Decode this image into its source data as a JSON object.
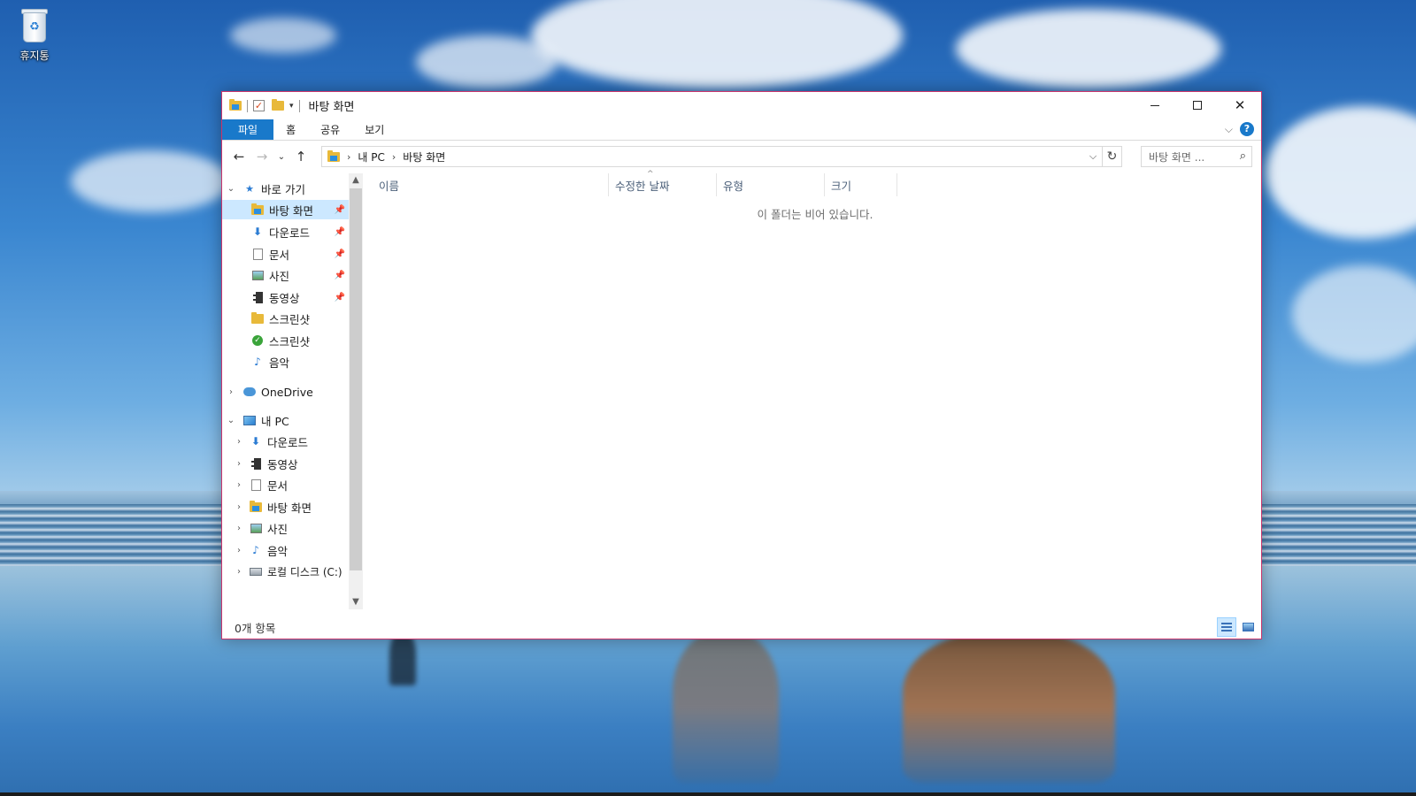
{
  "desktop": {
    "recycle_bin_label": "휴지통"
  },
  "window": {
    "title": "바탕 화면",
    "accent_color": "#1979ca",
    "border_color": "#c9356c",
    "controls": {
      "minimize": "minimize",
      "maximize": "maximize",
      "close": "✕"
    }
  },
  "ribbon": {
    "tabs": [
      {
        "label": "파일",
        "active": true
      },
      {
        "label": "홈"
      },
      {
        "label": "공유"
      },
      {
        "label": "보기"
      }
    ]
  },
  "address": {
    "crumbs": [
      "내 PC",
      "바탕 화면"
    ]
  },
  "search": {
    "placeholder": "바탕 화면 ..."
  },
  "nav": {
    "quick_access": "바로 가기",
    "quick_items": [
      {
        "label": "바탕 화면",
        "icon": "desktop-folder-icon",
        "pinned": true,
        "selected": true
      },
      {
        "label": "다운로드",
        "icon": "downloads-folder-icon",
        "pinned": true
      },
      {
        "label": "문서",
        "icon": "documents-folder-icon",
        "pinned": true
      },
      {
        "label": "사진",
        "icon": "pictures-folder-icon",
        "pinned": true
      },
      {
        "label": "동영상",
        "icon": "videos-folder-icon",
        "pinned": true
      },
      {
        "label": "스크린샷",
        "icon": "folder-icon",
        "pinned": false
      },
      {
        "label": "스크린샷",
        "icon": "synced-folder-icon",
        "pinned": false
      },
      {
        "label": "음악",
        "icon": "music-folder-icon",
        "pinned": false
      }
    ],
    "onedrive": "OneDrive",
    "this_pc": "내 PC",
    "pc_items": [
      {
        "label": "다운로드",
        "icon": "downloads-folder-icon"
      },
      {
        "label": "동영상",
        "icon": "videos-folder-icon"
      },
      {
        "label": "문서",
        "icon": "documents-folder-icon"
      },
      {
        "label": "바탕 화면",
        "icon": "desktop-folder-icon"
      },
      {
        "label": "사진",
        "icon": "pictures-folder-icon"
      },
      {
        "label": "음악",
        "icon": "music-folder-icon"
      },
      {
        "label": "로컬 디스크 (C:)",
        "icon": "local-disk-icon"
      }
    ]
  },
  "content": {
    "columns": [
      "이름",
      "수정한 날짜",
      "유형",
      "크기"
    ],
    "empty_message": "이 폴더는 비어 있습니다."
  },
  "status": {
    "item_count": "0개 항목"
  }
}
